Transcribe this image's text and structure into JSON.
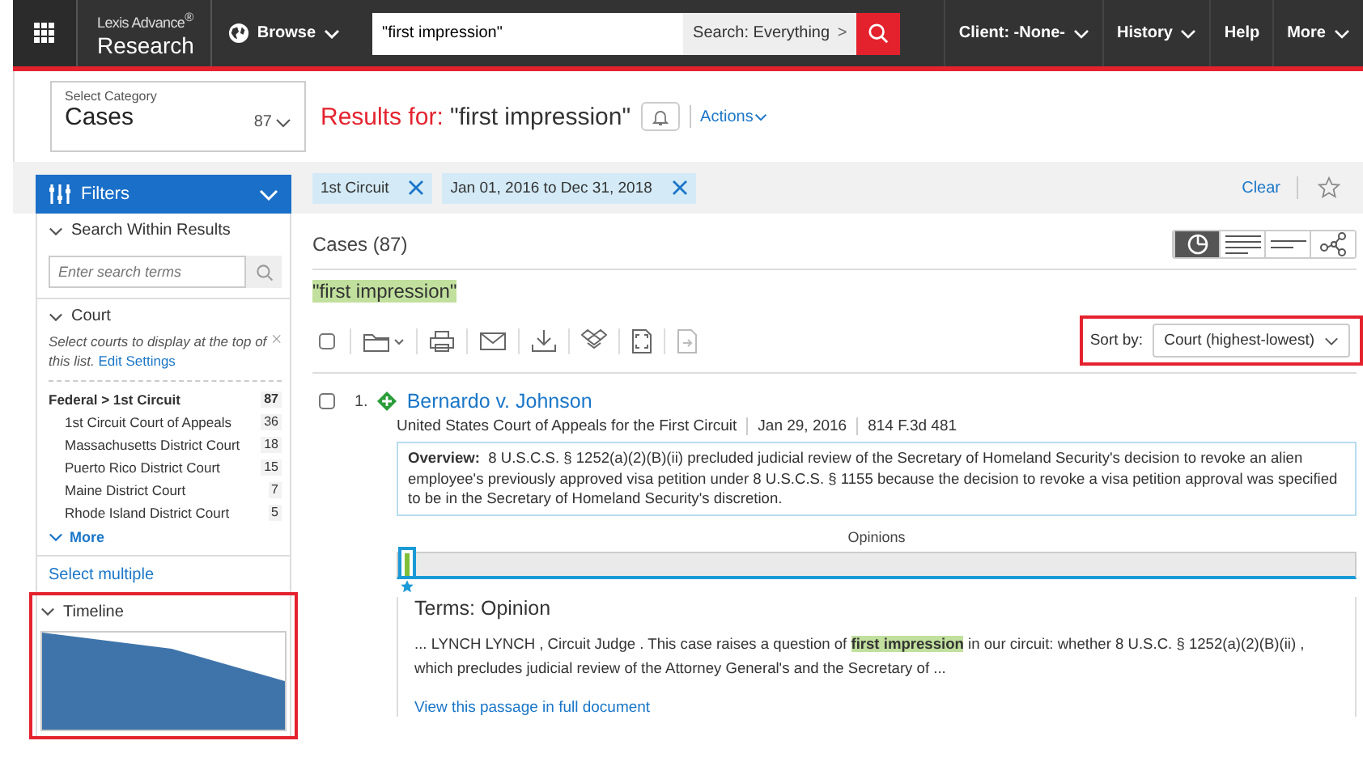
{
  "topbar": {
    "brand_top": "Lexis Advance$^{®}$",
    "brand_bottom": "Research",
    "browse": "Browse",
    "search_value": "\"first impression\"",
    "scope": "Search: Everything",
    "scope_arrow": ">",
    "nav": [
      {
        "label": "Client: -None-",
        "dropdown": true
      },
      {
        "label": "History",
        "dropdown": true
      },
      {
        "label": "Help",
        "dropdown": false
      },
      {
        "label": "More",
        "dropdown": true
      }
    ]
  },
  "category": {
    "label": "Select Category",
    "value": "Cases",
    "count": "87"
  },
  "results_header": {
    "prefix": "Results for:",
    "query": "\"first impression\"",
    "actions": "Actions"
  },
  "filter_chips": [
    {
      "label": "1st Circuit"
    },
    {
      "label": "Jan 01, 2016 to Dec 31, 2018"
    }
  ],
  "clear": "Clear",
  "sidebar": {
    "filters_title": "Filters",
    "search_within": {
      "title": "Search Within Results",
      "placeholder": "Enter search terms"
    },
    "court": {
      "title": "Court",
      "hint": "Select courts to display at the top of this list.",
      "hint_link": "Edit Settings",
      "group": {
        "name": "Federal > 1st Circuit",
        "count": "87"
      },
      "items": [
        {
          "name": "1st Circuit Court of Appeals",
          "count": "36"
        },
        {
          "name": "Massachusetts District Court",
          "count": "18"
        },
        {
          "name": "Puerto Rico District Court",
          "count": "15"
        },
        {
          "name": "Maine District Court",
          "count": "7"
        },
        {
          "name": "Rhode Island District Court",
          "count": "5"
        }
      ],
      "more": "More"
    },
    "select_multiple": "Select multiple",
    "timeline": {
      "title": "Timeline",
      "highlighted": true
    }
  },
  "main": {
    "heading": "Cases (87)",
    "view_modes": [
      {
        "kind": "chart",
        "selected": true
      },
      {
        "kind": "full",
        "selected": false
      },
      {
        "kind": "short",
        "selected": false
      },
      {
        "kind": "graph",
        "selected": false
      }
    ],
    "search_term": "\"first impression\"",
    "select_all_checked": false,
    "sort": {
      "label": "Sort by:",
      "value": "Court (highest-lowest)",
      "highlighted": true
    },
    "results": [
      {
        "checked": false,
        "number": "1.",
        "title": "Bernardo v. Johnson",
        "court": "United States Court of Appeals for the First Circuit",
        "date": "Jan 29, 2016",
        "citation": "814 F.3d 481",
        "overview_label": "Overview:",
        "overview": "8 U.S.C.S. § 1252(a)(2)(B)(ii) precluded judicial review of the Secretary of Homeland Security's decision to revoke an alien employee's previously approved visa petition under 8 U.S.C.S. § 1155 because the decision to revoke a visa petition approval was specified to be in the Secretary of Homeland Security's discretion.",
        "opinions_label": "Opinions",
        "terms_heading": "Terms: Opinion",
        "passage": "... LYNCH LYNCH , Circuit Judge . This case raises a question of **first impression** in our circuit: whether 8 U.S.C. § 1252(a)(2)(B)(ii) , which precludes judicial review of the Attorney General's and the Secretary of ...",
        "passage_link": "View this passage in full document"
      }
    ]
  }
}
